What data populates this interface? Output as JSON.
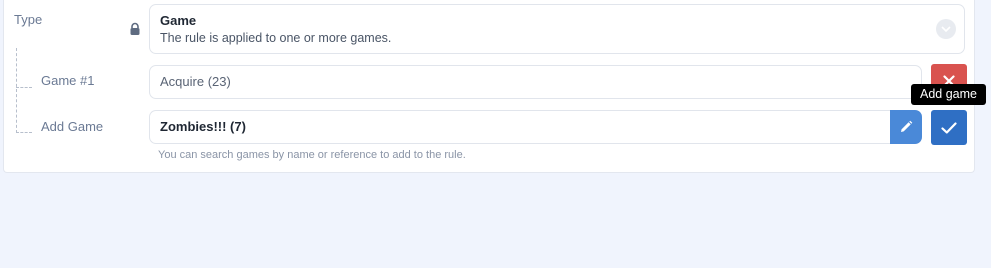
{
  "type_row": {
    "label": "Type",
    "selected_title": "Game",
    "selected_description": "The rule is applied to one or more games."
  },
  "game_rows": [
    {
      "label": "Game #1",
      "value": "Acquire (23)"
    }
  ],
  "add_row": {
    "label": "Add Game",
    "value": "Zombies!!! (7)",
    "help_text": "You can search games by name or reference to add to the rule."
  },
  "tooltip": {
    "text": "Add game"
  },
  "icons": {
    "lock": "lock-icon",
    "chevron": "chevron-down-icon",
    "remove": "close-icon",
    "edit": "pencil-icon",
    "confirm": "check-icon"
  },
  "colors": {
    "background": "#f0f4fd",
    "remove_button": "#d9534f",
    "edit_button": "#4a89d8",
    "confirm_button": "#2f6fc4"
  }
}
